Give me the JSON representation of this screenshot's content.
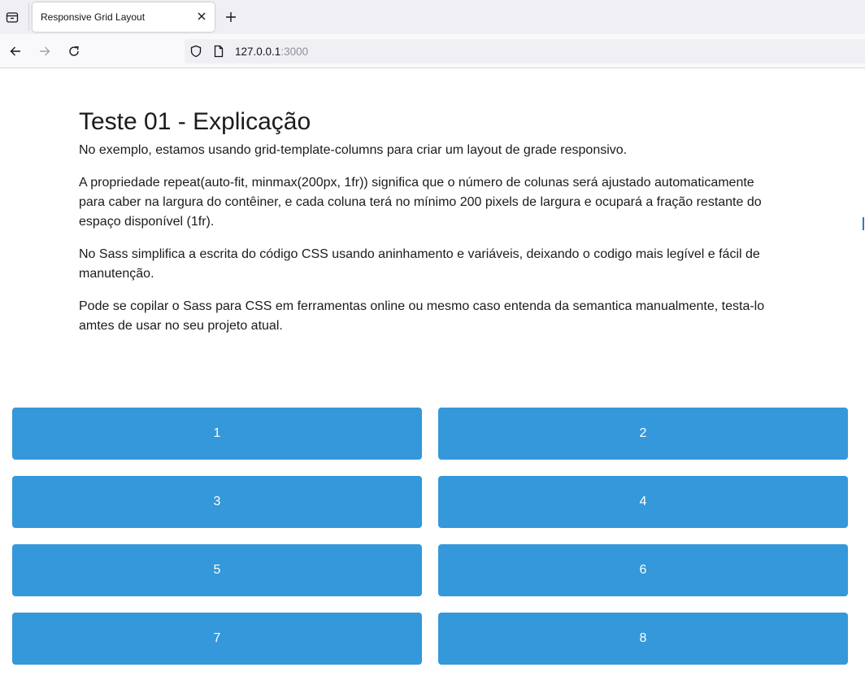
{
  "browser": {
    "tab": {
      "title": "Responsive Grid Layout"
    },
    "url": {
      "host": "127.0.0.1",
      "port": ":3000"
    },
    "icons": {
      "tab_list": "tab-list-icon",
      "close": "close-icon",
      "new_tab": "plus-icon",
      "back": "back-arrow-icon",
      "forward": "forward-arrow-icon",
      "reload": "reload-icon",
      "shield": "shield-icon",
      "page": "page-icon"
    }
  },
  "article": {
    "title": "Teste 01 - Explicação",
    "paragraphs": [
      "No exemplo, estamos usando grid-template-columns para criar um layout de grade responsivo.",
      "A propriedade repeat(auto-fit, minmax(200px, 1fr)) significa que o número de colunas será ajustado automaticamente para caber na largura do contêiner, e cada coluna terá no mínimo 200 pixels de largura e ocupará a fração restante do espaço disponível (1fr).",
      "No Sass simplifica a escrita do código CSS usando aninhamento e variáveis, deixando o codigo mais legível e fácil de manutenção.",
      "Pode se copilar o Sass para CSS em ferramentas online ou mesmo caso entenda da semantica manualmente, testa-lo amtes de usar no seu projeto atual."
    ]
  },
  "grid": {
    "item_color": "#3498db",
    "items": [
      "1",
      "2",
      "3",
      "4",
      "5",
      "6",
      "7",
      "8"
    ]
  }
}
